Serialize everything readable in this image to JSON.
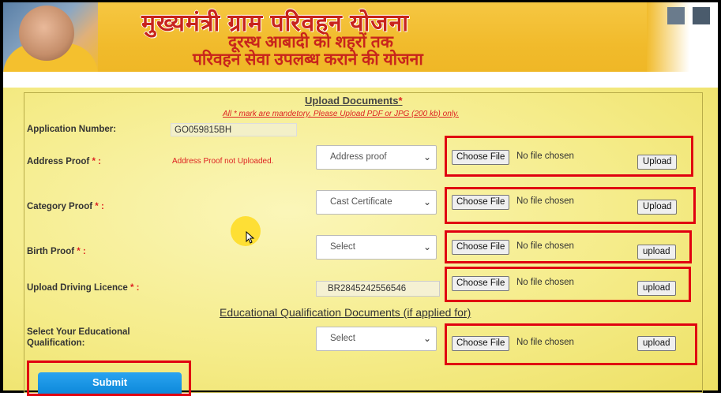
{
  "banner": {
    "title": "मुख्यमंत्री ग्राम परिवहन योजना",
    "subtitle_line1": "दूरस्थ आबादी को शहरों तक",
    "subtitle_line2": "परिवहन सेवा उपलब्ध कराने की योजना"
  },
  "section": {
    "title": "Upload Documents",
    "title_star": "*",
    "note": "All * mark are mandetory, Please Upload PDF or JPG (200 kb) only."
  },
  "application": {
    "label": "Application Number:",
    "value": "GO059815BH"
  },
  "rows": [
    {
      "label": "Address Proof",
      "star": " * :",
      "status": "Address Proof not Uploaded.",
      "select": "Address proof",
      "choose": "Choose File",
      "nofile": "No file chosen",
      "upload": "Upload"
    },
    {
      "label": "Category Proof",
      "star": " * :",
      "select": "Cast Certificate",
      "choose": "Choose File",
      "nofile": "No file chosen",
      "upload": "Upload"
    },
    {
      "label": "Birth Proof",
      "star": " * :",
      "select": "Select",
      "choose": "Choose File",
      "nofile": "No file chosen",
      "upload": "upload"
    },
    {
      "label": "Upload Driving Licence",
      "star": " * :",
      "value": "BR2845242556546",
      "choose": "Choose File",
      "nofile": "No file chosen",
      "upload": "upload"
    }
  ],
  "education": {
    "title": "Educational Qualification Documents (if applied for)",
    "label_line1": "Select Your Educational",
    "label_line2": "Qualification:",
    "select": "Select",
    "choose": "Choose File",
    "nofile": "No file chosen",
    "upload": "upload"
  },
  "submit": {
    "label": "Submit"
  },
  "colors": {
    "banner": "#f1bb2c",
    "content": "#f5ec8a",
    "highlight_box": "#e00010",
    "submit": "#0a86d8",
    "error": "#d22222"
  }
}
